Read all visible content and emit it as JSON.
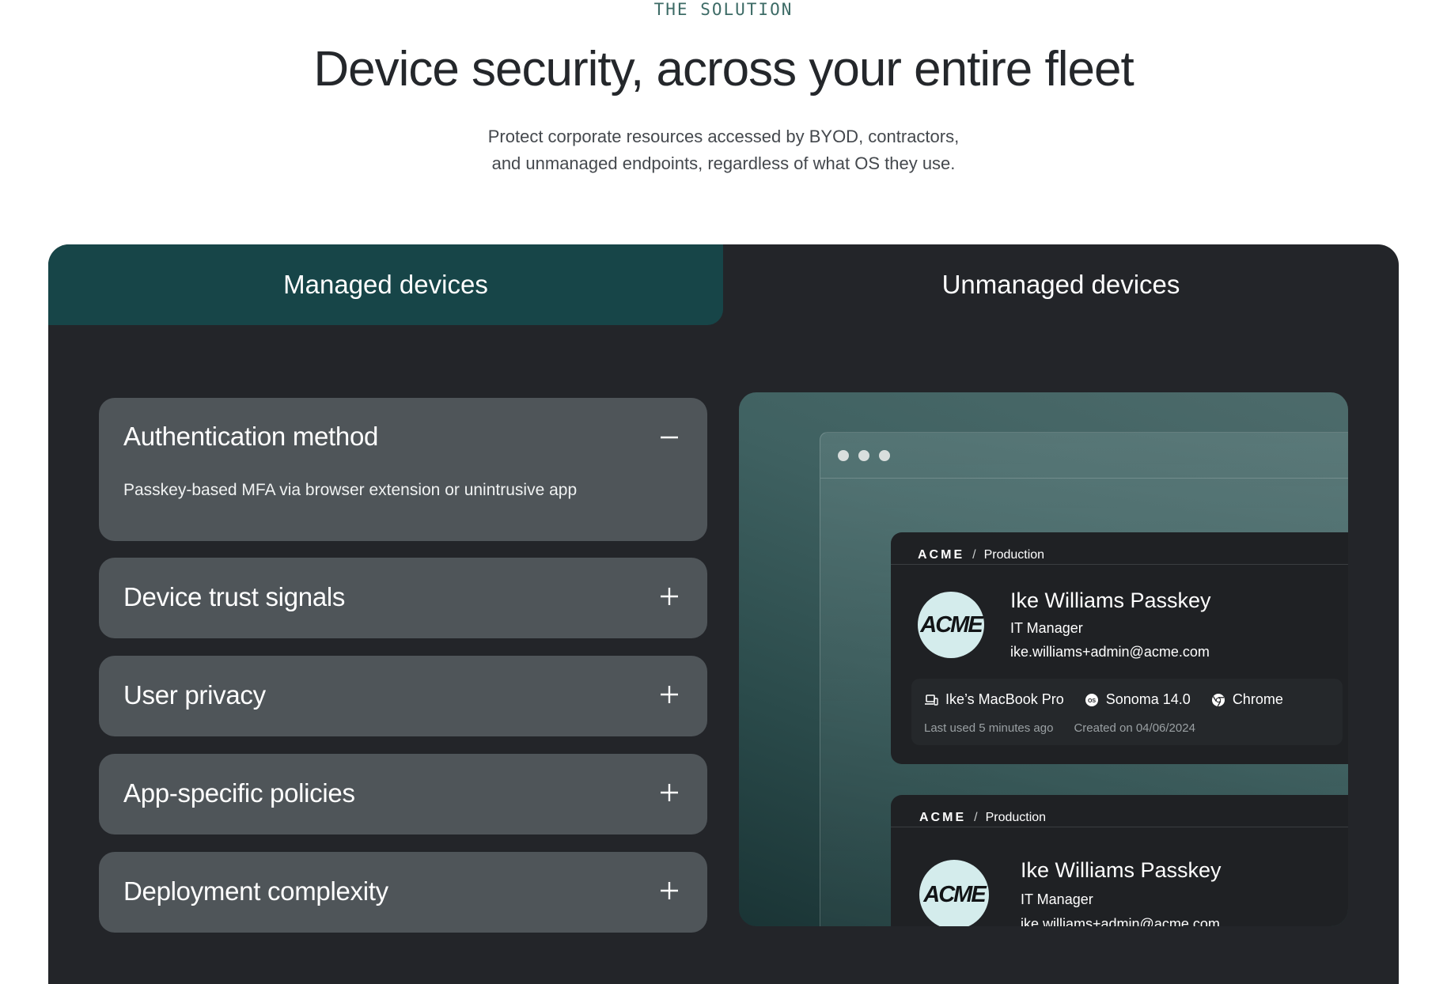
{
  "eyebrow": "THE SOLUTION",
  "headline": "Device security, across your entire fleet",
  "subtext": {
    "line1": "Protect corporate resources accessed by BYOD, contractors,",
    "line2": "and unmanaged endpoints, regardless of what OS they use."
  },
  "tabs": {
    "managed": "Managed devices",
    "unmanaged": "Unmanaged devices",
    "active": "managed"
  },
  "accordion": [
    {
      "title": "Authentication method",
      "expanded": true,
      "description": "Passkey-based MFA via browser extension or unintrusive app",
      "icon": "minus-icon"
    },
    {
      "title": "Device trust signals",
      "expanded": false,
      "icon": "plus-icon"
    },
    {
      "title": "User privacy",
      "expanded": false,
      "icon": "plus-icon"
    },
    {
      "title": "App-specific policies",
      "expanded": false,
      "icon": "plus-icon"
    },
    {
      "title": "Deployment complexity",
      "expanded": false,
      "icon": "plus-icon"
    }
  ],
  "cards": [
    {
      "brand": "ACME",
      "separator": "/",
      "environment": "Production",
      "avatar_text": "ACME",
      "name": "Ike Williams Passkey",
      "role": "IT Manager",
      "email": "ike.williams+admin@acme.com",
      "device": "Ike’s MacBook Pro",
      "os": "Sonoma 14.0",
      "browser": "Chrome",
      "last_used": "Last used 5 minutes ago",
      "created": "Created on 04/06/2024"
    },
    {
      "brand": "ACME",
      "separator": "/",
      "environment": "Production",
      "avatar_text": "ACME",
      "name": "Ike Williams Passkey",
      "role": "IT Manager",
      "email": "ike.williams+admin@acme.com"
    }
  ],
  "colors": {
    "panel_bg": "#232529",
    "active_tab": "#174548",
    "accordion_bg": "#4f5559",
    "eyebrow": "#3d6b66",
    "avatar_bg": "#d4ecec"
  }
}
